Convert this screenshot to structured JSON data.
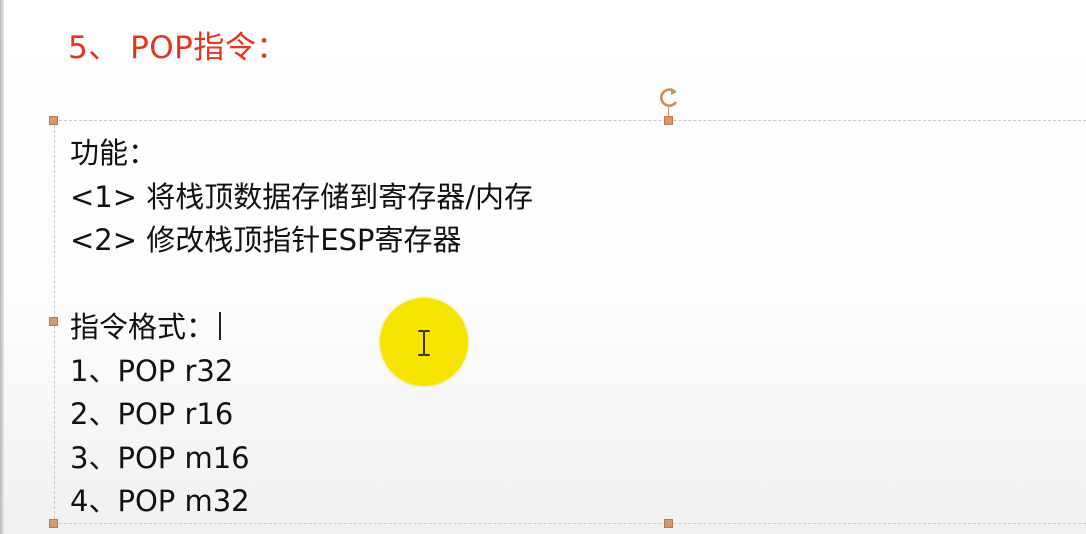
{
  "slide": {
    "heading": "5、 POP指令："
  },
  "textbox": {
    "lines": [
      "功能：",
      "<1> 将栈顶数据存储到寄存器/内存",
      "<2> 修改栈顶指针ESP寄存器",
      "",
      "指令格式：",
      "1、POP r32",
      "2、POP r16",
      "3、POP m16",
      "4、POP m32"
    ]
  },
  "colors": {
    "heading": "#e8341c",
    "handle": "#d7986a",
    "cursor_highlight": "#f7e400"
  },
  "icons": {
    "rotate": "rotate-handle-icon",
    "cursor": "ibeam-cursor-icon"
  }
}
